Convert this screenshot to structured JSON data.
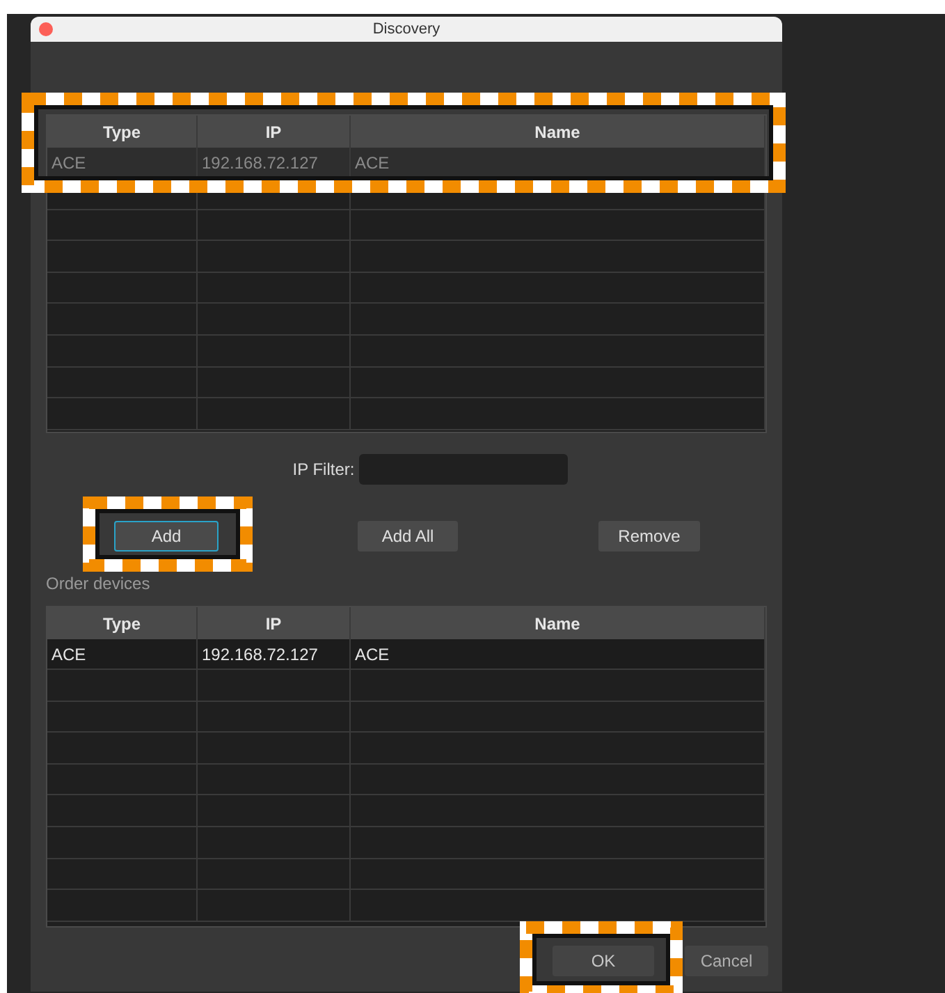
{
  "window": {
    "title": "Discovery"
  },
  "found_table": {
    "columns": [
      "Type",
      "IP",
      "Name"
    ],
    "rows": [
      {
        "cells": [
          "ACE",
          "192.168.72.127",
          "ACE"
        ]
      }
    ]
  },
  "ip_filter": {
    "label": "IP Filter:"
  },
  "buttons": [
    "Add",
    "Add All",
    "Remove"
  ],
  "order_label": "Order devices",
  "order_table": {
    "columns": [
      "Type",
      "IP",
      "Name"
    ],
    "rows": [
      {
        "cells": [
          "ACE",
          "192.168.72.127",
          "ACE"
        ]
      }
    ]
  },
  "footer_buttons": [
    "OK",
    "Cancel"
  ]
}
